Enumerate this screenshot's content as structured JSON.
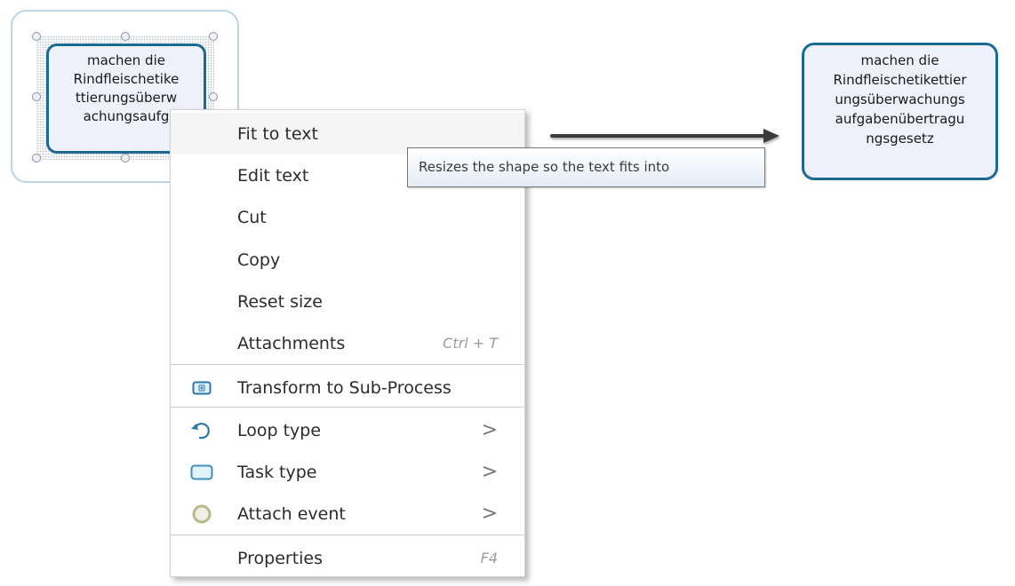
{
  "canvas": {
    "selected_task": {
      "lines": [
        "machen die",
        "Rindfleischetike",
        "ttierungsüberw",
        "achungsaufg"
      ]
    },
    "result_task": {
      "lines": [
        "machen die",
        "Rindfleischetikettier",
        "ungsüberwachungs",
        "aufgabenübertragu",
        "ngsgesetz"
      ]
    },
    "colors": {
      "task_border": "#1c6a94",
      "task_fill": "#eef1fc",
      "frame_border": "#b9d6e6",
      "arrow": "#3a3a3a"
    }
  },
  "context_menu": {
    "items": [
      {
        "label": "Fit to text",
        "icon": null,
        "shortcut": "",
        "submenu": false,
        "hovered": true
      },
      {
        "label": "Edit text",
        "icon": null,
        "shortcut": "",
        "submenu": false
      },
      {
        "label": "Cut",
        "icon": null,
        "shortcut": "",
        "submenu": false
      },
      {
        "label": "Copy",
        "icon": null,
        "shortcut": "",
        "submenu": false
      },
      {
        "label": "Reset size",
        "icon": null,
        "shortcut": "",
        "submenu": false
      },
      {
        "label": "Attachments",
        "icon": null,
        "shortcut": "Ctrl + T",
        "submenu": false
      },
      {
        "label": "Transform to Sub-Process",
        "icon": "subprocess-icon",
        "shortcut": "",
        "submenu": false
      },
      {
        "label": "Loop type",
        "icon": "loop-icon",
        "shortcut": "",
        "submenu": true
      },
      {
        "label": "Task type",
        "icon": "task-icon",
        "shortcut": "",
        "submenu": true
      },
      {
        "label": "Attach event",
        "icon": "event-circle-icon",
        "shortcut": "",
        "submenu": true
      },
      {
        "label": "Properties",
        "icon": null,
        "shortcut": "F4",
        "submenu": false
      }
    ],
    "chevron": ">"
  },
  "tooltip": {
    "text": "Resizes the shape so the text fits into"
  }
}
